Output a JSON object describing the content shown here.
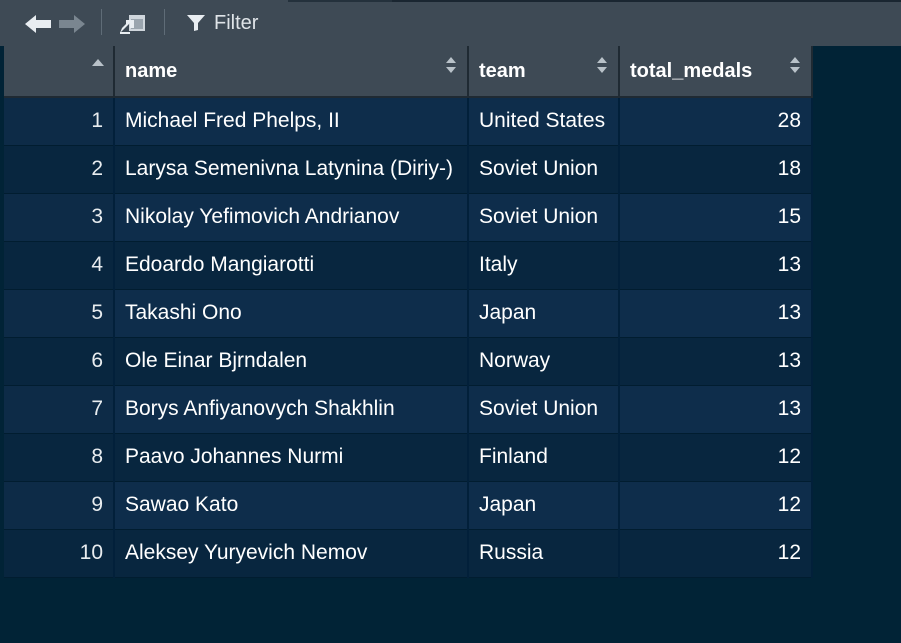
{
  "toolbar": {
    "filter_label": "Filter"
  },
  "table": {
    "columns": [
      "",
      "name",
      "team",
      "total_medals"
    ],
    "rows": [
      {
        "row": "1",
        "name": "Michael Fred Phelps, II",
        "team": "United States",
        "total_medals": "28"
      },
      {
        "row": "2",
        "name": "Larysa Semenivna Latynina (Diriy-)",
        "team": "Soviet Union",
        "total_medals": "18"
      },
      {
        "row": "3",
        "name": "Nikolay Yefimovich Andrianov",
        "team": "Soviet Union",
        "total_medals": "15"
      },
      {
        "row": "4",
        "name": "Edoardo Mangiarotti",
        "team": "Italy",
        "total_medals": "13"
      },
      {
        "row": "5",
        "name": "Takashi Ono",
        "team": "Japan",
        "total_medals": "13"
      },
      {
        "row": "6",
        "name": "Ole Einar Bjrndalen",
        "team": "Norway",
        "total_medals": "13"
      },
      {
        "row": "7",
        "name": "Borys Anfiyanovych Shakhlin",
        "team": "Soviet Union",
        "total_medals": "13"
      },
      {
        "row": "8",
        "name": "Paavo Johannes Nurmi",
        "team": "Finland",
        "total_medals": "12"
      },
      {
        "row": "9",
        "name": "Sawao Kato",
        "team": "Japan",
        "total_medals": "12"
      },
      {
        "row": "10",
        "name": "Aleksey Yuryevich Nemov",
        "team": "Russia",
        "total_medals": "12"
      }
    ]
  },
  "colors": {
    "background": "#012336",
    "toolbar": "#3e4a55",
    "row_odd": "#0e2d4b",
    "row_even": "#08263f"
  }
}
